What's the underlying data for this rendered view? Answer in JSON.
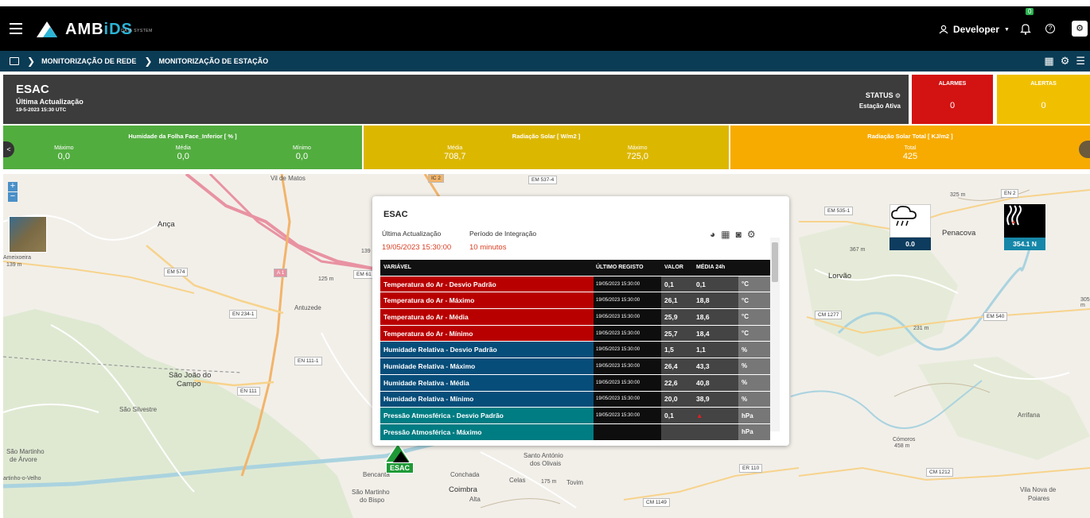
{
  "header": {
    "brand_a": "AMB",
    "brand_b": "iDS",
    "brand_sub": "DATA SYSTEM",
    "user": "Developer",
    "notification_count": "0"
  },
  "breadcrumb": {
    "item1": "MONITORIZAÇÃO DE REDE",
    "item2": "MONITORIZAÇÃO DE ESTAÇÃO"
  },
  "station": {
    "name": "ESAC",
    "update_label": "Última Actualização",
    "update_value": "19-5-2023 15:30 UTC",
    "status_label": "STATUS",
    "status_value": "Estação Ativa"
  },
  "alarms": {
    "label": "ALARMES",
    "value": "0"
  },
  "alerts": {
    "label": "ALERTAS",
    "value": "0"
  },
  "sensors": [
    {
      "title": "Humidade da Folha Face_Inferior [ % ]",
      "k1": "Máximo",
      "v1": "0,0",
      "k2": "Média",
      "v2": "0,0",
      "k3": "Mínimo",
      "v3": "0,0"
    },
    {
      "title": "Radiação Solar [ W/m2 ]",
      "k1": "Média",
      "v1": "708,7",
      "k2": "Máximo",
      "v2": "725,0"
    },
    {
      "title": "Radiação Solar Total [ KJ/m2 ]",
      "k1": "Total",
      "v1": "425"
    }
  ],
  "map": {
    "labels": {
      "vil_de_matos": "Vil de Matos",
      "anca": "Ança",
      "ameixoeira": "Ameixoeira",
      "a139": "139 m",
      "antuzede": "Antuzede",
      "sjoao": "São João do",
      "campo": "Campo",
      "ssilvestre": "São Silvestre",
      "smartinho1": "São Martinho",
      "darvore": "de Árvore",
      "velho": "artinho-o-Velho",
      "benc": "Bencanta",
      "conchada": "Conchada",
      "celas": "Celas",
      "tovim": "Tovim",
      "smartinho2": "São Martinho",
      "dobispo": "do Bispo",
      "coimbra": "Coimbra",
      "alta": "Alta",
      "santo": "Santo António",
      "olivais": "dos Olivais",
      "lorvao": "Lorvão",
      "penacova": "Penacova",
      "arrifana": "Arrifana",
      "comoros": "Cómoros",
      "m458": "458 m",
      "vila1": "Vila Nova de",
      "vila2": "Poiares",
      "m325": "325 m",
      "m367": "367 m",
      "m305": "305 m",
      "m231": "231 m",
      "m125": "125 m",
      "m175": "175 m",
      "m139b": "139"
    },
    "roads": {
      "em574": "EM 574",
      "a1": "A 1",
      "en234": "EN 234-1",
      "en111_1": "EN 111-1",
      "en111": "EN 111",
      "em537": "EM 537-4",
      "em535": "EM 535-1",
      "en2": "EN 2",
      "cm1277": "CM 1277",
      "em540": "EM 540",
      "er110": "ER 110",
      "cm1212": "CM 1212",
      "cm1149": "CM 1149",
      "em61": "EM 61",
      "ic2": "IC 2"
    },
    "weather_rain": "0.0",
    "weather_wind": "354.1 N",
    "marker_label": "ESAC"
  },
  "popup": {
    "title": "ESAC",
    "update_label": "Última Actualização",
    "period_label": "Período de Integração",
    "update_value": "19/05/2023 15:30:00",
    "period_value": "10 minutos",
    "columns": [
      "VARIÁVEL",
      "ÚLTIMO REGISTO",
      "VALOR",
      "MÉDIA 24h",
      ""
    ],
    "rows": [
      {
        "var": "Temperatura do Ar - Desvio Padrão",
        "reg": "19/05/2023 15:30:00",
        "val": "0,1",
        "med": "0,1",
        "unit": "°C",
        "color": "red"
      },
      {
        "var": "Temperatura do Ar - Máximo",
        "reg": "19/05/2023 15:30:00",
        "val": "26,1",
        "med": "18,8",
        "unit": "°C",
        "color": "red"
      },
      {
        "var": "Temperatura do Ar - Média",
        "reg": "19/05/2023 15:30:00",
        "val": "25,9",
        "med": "18,6",
        "unit": "°C",
        "color": "red"
      },
      {
        "var": "Temperatura do Ar - Mínimo",
        "reg": "19/05/2023 15:30:00",
        "val": "25,7",
        "med": "18,4",
        "unit": "°C",
        "color": "red"
      },
      {
        "var": "Humidade Relativa - Desvio Padrão",
        "reg": "19/05/2023 15:30:00",
        "val": "1,5",
        "med": "1,1",
        "unit": "%",
        "color": "blue"
      },
      {
        "var": "Humidade Relativa - Máximo",
        "reg": "19/05/2023 15:30:00",
        "val": "26,4",
        "med": "43,3",
        "unit": "%",
        "color": "blue"
      },
      {
        "var": "Humidade Relativa - Média",
        "reg": "19/05/2023 15:30:00",
        "val": "22,6",
        "med": "40,8",
        "unit": "%",
        "color": "blue"
      },
      {
        "var": "Humidade Relativa - Mínimo",
        "reg": "19/05/2023 15:30:00",
        "val": "20,0",
        "med": "38,9",
        "unit": "%",
        "color": "blue"
      },
      {
        "var": "Pressão Atmosférica - Desvio Padrão",
        "reg": "19/05/2023 15:30:00",
        "val": "0,1",
        "med": "",
        "unit": "hPa",
        "color": "teal"
      },
      {
        "var": "Pressão Atmosférica - Máximo",
        "reg": "",
        "val": "",
        "med": "",
        "unit": "hPa",
        "color": "teal"
      }
    ]
  }
}
